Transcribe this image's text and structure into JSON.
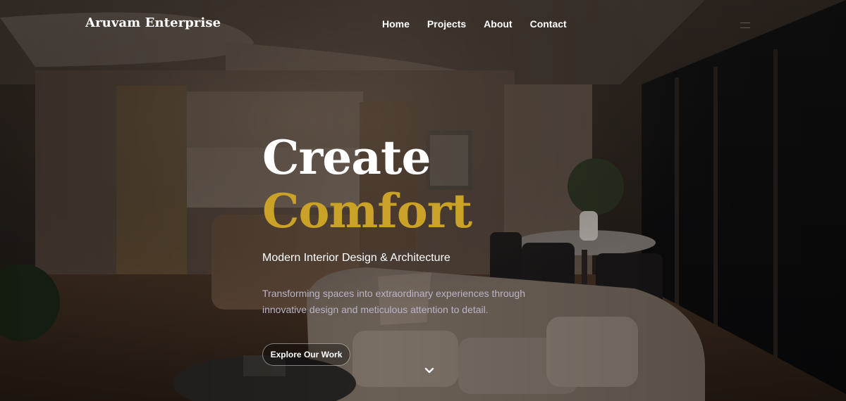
{
  "brand": {
    "name": "Aruvam Enterprise"
  },
  "nav": {
    "links": [
      "Home",
      "Projects",
      "About",
      "Contact"
    ]
  },
  "hero": {
    "title_line1": "Create",
    "title_line2": "Comfort",
    "subtitle": "Modern Interior Design & Architecture",
    "description": "Transforming spaces into extraordinary experiences through innovative design and meticulous attention to detail.",
    "cta_label": "Explore Our Work"
  },
  "colors": {
    "accent": "#c9a227",
    "text": "#ffffff",
    "muted": "#b9b4c8"
  },
  "icons": {
    "menu": "hamburger-icon",
    "scroll": "chevron-down-icon"
  }
}
